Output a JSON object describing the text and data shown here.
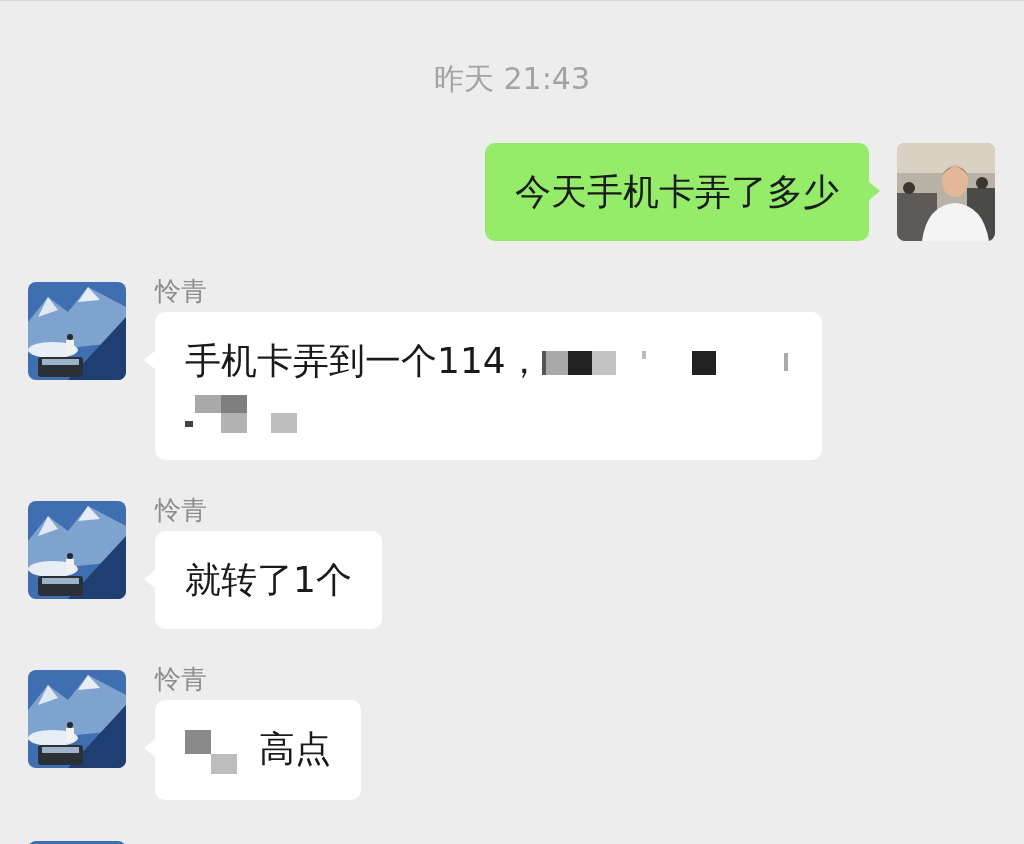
{
  "timestamp": "昨天 21:43",
  "messages": [
    {
      "kind": "outgoing",
      "parts": [
        {
          "kind": "text",
          "text": "今天手机卡弄了多少"
        }
      ]
    },
    {
      "kind": "incoming",
      "sender": "怜青",
      "parts": [
        {
          "kind": "text",
          "text": "手机卡弄到一个114，"
        },
        {
          "kind": "redacted"
        },
        {
          "kind": "break"
        },
        {
          "kind": "redacted"
        }
      ]
    },
    {
      "kind": "incoming",
      "sender": "怜青",
      "parts": [
        {
          "kind": "text",
          "text": "就转了1个"
        }
      ]
    },
    {
      "kind": "incoming",
      "sender": "怜青",
      "parts": [
        {
          "kind": "redacted"
        },
        {
          "kind": "text",
          "text": "高点"
        }
      ]
    },
    {
      "kind": "cut_off"
    }
  ]
}
